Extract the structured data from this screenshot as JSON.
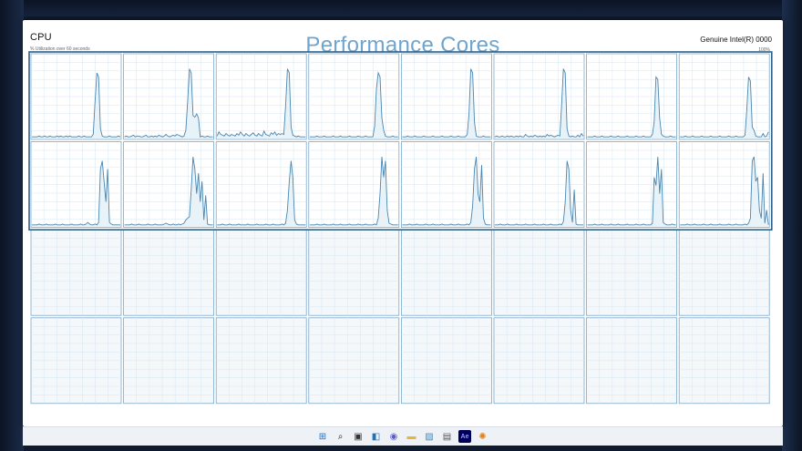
{
  "window": {
    "title": "CPU",
    "subtitle": "% Utilization over 60 seconds",
    "cpu_name": "Genuine Intel(R) 0000",
    "max_label": "100%"
  },
  "overlay": {
    "title": "Performance Cores",
    "highlight_color": "#2d5f87"
  },
  "graph_colors": {
    "line": "#4a86b0",
    "fill": "#e8f2f9",
    "grid": "#d6e6f1",
    "border": "#7aa7c7"
  },
  "cpu_graphs": {
    "rows": 4,
    "cols": 8,
    "active_rows": 2,
    "series": [
      [
        2,
        2,
        2,
        2,
        3,
        2,
        2,
        3,
        2,
        2,
        3,
        2,
        2,
        2,
        3,
        2,
        3,
        2,
        2,
        3,
        2,
        3,
        2,
        2,
        2,
        2,
        3,
        2,
        2,
        3,
        2,
        2,
        2,
        2,
        5,
        45,
        80,
        75,
        12,
        3,
        2,
        2,
        2,
        3,
        2,
        2,
        2,
        2,
        3,
        2
      ],
      [
        2,
        3,
        2,
        2,
        3,
        4,
        2,
        3,
        3,
        2,
        2,
        3,
        4,
        2,
        2,
        3,
        2,
        3,
        2,
        4,
        3,
        2,
        3,
        5,
        3,
        2,
        3,
        4,
        3,
        5,
        4,
        3,
        2,
        3,
        10,
        45,
        85,
        80,
        28,
        26,
        30,
        25,
        2,
        3,
        2,
        2,
        3,
        2,
        2,
        2
      ],
      [
        3,
        8,
        5,
        4,
        3,
        6,
        4,
        3,
        5,
        4,
        3,
        6,
        4,
        8,
        5,
        3,
        6,
        4,
        3,
        5,
        7,
        4,
        3,
        6,
        4,
        3,
        9,
        5,
        4,
        3,
        7,
        5,
        8,
        4,
        6,
        5,
        6,
        5,
        40,
        85,
        80,
        14,
        4,
        3,
        2,
        3,
        2,
        2,
        2,
        2
      ],
      [
        2,
        2,
        2,
        2,
        3,
        2,
        2,
        2,
        3,
        2,
        2,
        2,
        2,
        3,
        2,
        2,
        2,
        3,
        2,
        2,
        2,
        2,
        3,
        2,
        2,
        2,
        2,
        3,
        2,
        2,
        2,
        3,
        2,
        2,
        2,
        2,
        15,
        60,
        80,
        75,
        25,
        10,
        3,
        2,
        2,
        2,
        3,
        2,
        2,
        2
      ],
      [
        2,
        2,
        2,
        3,
        2,
        2,
        2,
        3,
        2,
        2,
        2,
        2,
        3,
        2,
        2,
        2,
        2,
        3,
        2,
        2,
        2,
        2,
        3,
        2,
        2,
        2,
        2,
        3,
        2,
        2,
        2,
        3,
        2,
        2,
        2,
        2,
        5,
        30,
        85,
        80,
        20,
        3,
        2,
        2,
        2,
        3,
        2,
        2,
        2,
        2
      ],
      [
        2,
        3,
        2,
        2,
        3,
        2,
        2,
        3,
        2,
        3,
        2,
        2,
        3,
        2,
        3,
        2,
        2,
        5,
        3,
        2,
        3,
        2,
        4,
        3,
        2,
        3,
        2,
        3,
        2,
        5,
        3,
        4,
        3,
        2,
        3,
        4,
        3,
        40,
        85,
        80,
        12,
        3,
        2,
        3,
        2,
        2,
        4,
        2,
        6,
        3
      ],
      [
        2,
        2,
        2,
        2,
        3,
        2,
        2,
        2,
        3,
        2,
        2,
        2,
        2,
        3,
        2,
        2,
        2,
        3,
        2,
        2,
        2,
        2,
        3,
        2,
        2,
        2,
        2,
        3,
        2,
        2,
        2,
        3,
        2,
        2,
        2,
        2,
        5,
        20,
        75,
        72,
        25,
        5,
        3,
        2,
        2,
        2,
        3,
        2,
        2,
        2
      ],
      [
        2,
        2,
        2,
        3,
        2,
        2,
        2,
        3,
        2,
        2,
        2,
        2,
        3,
        2,
        2,
        2,
        2,
        3,
        2,
        2,
        2,
        2,
        3,
        2,
        2,
        2,
        2,
        3,
        2,
        2,
        2,
        3,
        2,
        2,
        2,
        2,
        4,
        35,
        75,
        70,
        14,
        10,
        3,
        2,
        2,
        2,
        6,
        2,
        3,
        8
      ],
      [
        2,
        2,
        2,
        2,
        3,
        2,
        2,
        2,
        3,
        2,
        2,
        2,
        2,
        3,
        2,
        2,
        2,
        3,
        2,
        2,
        2,
        2,
        3,
        2,
        2,
        2,
        2,
        3,
        2,
        2,
        3,
        5,
        3,
        2,
        2,
        3,
        2,
        5,
        70,
        80,
        55,
        30,
        70,
        5,
        3,
        2,
        2,
        2,
        2,
        2
      ],
      [
        2,
        2,
        2,
        2,
        3,
        2,
        2,
        2,
        3,
        2,
        2,
        2,
        2,
        3,
        2,
        2,
        2,
        3,
        2,
        2,
        2,
        2,
        3,
        4,
        3,
        2,
        2,
        3,
        2,
        2,
        3,
        2,
        3,
        4,
        8,
        10,
        12,
        45,
        85,
        70,
        40,
        65,
        30,
        55,
        8,
        38,
        3,
        2,
        2,
        2
      ],
      [
        2,
        2,
        2,
        3,
        2,
        2,
        2,
        3,
        2,
        2,
        2,
        2,
        3,
        2,
        2,
        2,
        2,
        3,
        2,
        2,
        2,
        2,
        3,
        2,
        2,
        2,
        2,
        3,
        2,
        2,
        2,
        3,
        2,
        2,
        2,
        2,
        3,
        2,
        4,
        20,
        55,
        80,
        60,
        8,
        3,
        2,
        2,
        2,
        2,
        2
      ],
      [
        2,
        2,
        2,
        2,
        3,
        2,
        2,
        2,
        3,
        2,
        2,
        2,
        2,
        3,
        2,
        2,
        2,
        3,
        2,
        2,
        2,
        2,
        3,
        2,
        2,
        2,
        2,
        3,
        2,
        2,
        2,
        3,
        2,
        2,
        2,
        2,
        3,
        2,
        10,
        40,
        85,
        60,
        80,
        20,
        4,
        3,
        2,
        2,
        2,
        2
      ],
      [
        2,
        2,
        2,
        2,
        3,
        2,
        2,
        2,
        3,
        2,
        2,
        2,
        2,
        3,
        2,
        2,
        2,
        3,
        2,
        2,
        2,
        2,
        3,
        2,
        2,
        2,
        2,
        3,
        2,
        2,
        2,
        3,
        2,
        2,
        2,
        2,
        3,
        2,
        5,
        25,
        70,
        85,
        40,
        30,
        75,
        10,
        3,
        2,
        2,
        2
      ],
      [
        2,
        2,
        2,
        3,
        2,
        2,
        2,
        3,
        2,
        2,
        2,
        2,
        3,
        2,
        2,
        2,
        2,
        3,
        2,
        2,
        2,
        2,
        3,
        2,
        2,
        2,
        2,
        3,
        2,
        2,
        2,
        3,
        2,
        2,
        2,
        2,
        3,
        2,
        6,
        30,
        80,
        70,
        20,
        5,
        45,
        3,
        2,
        2,
        2,
        2
      ],
      [
        2,
        2,
        2,
        2,
        3,
        2,
        2,
        2,
        3,
        2,
        2,
        2,
        2,
        3,
        2,
        2,
        2,
        3,
        2,
        2,
        2,
        2,
        3,
        2,
        2,
        2,
        2,
        3,
        2,
        2,
        2,
        3,
        2,
        2,
        2,
        2,
        4,
        60,
        50,
        85,
        40,
        70,
        5,
        3,
        2,
        2,
        2,
        3,
        2,
        2
      ],
      [
        2,
        2,
        2,
        2,
        3,
        2,
        2,
        2,
        3,
        2,
        2,
        2,
        2,
        3,
        2,
        2,
        2,
        3,
        2,
        2,
        2,
        2,
        3,
        2,
        2,
        2,
        2,
        3,
        2,
        2,
        2,
        3,
        2,
        2,
        2,
        2,
        3,
        2,
        4,
        10,
        80,
        85,
        55,
        60,
        20,
        10,
        65,
        4,
        20,
        2
      ]
    ]
  },
  "taskbar": {
    "items": [
      {
        "name": "start-icon",
        "glyph": "⊞",
        "color": "#1a73c9"
      },
      {
        "name": "search-icon",
        "glyph": "⌕",
        "color": "#222222"
      },
      {
        "name": "task-view-icon",
        "glyph": "▣",
        "color": "#333333"
      },
      {
        "name": "widgets-icon",
        "glyph": "◧",
        "color": "#1f73b7"
      },
      {
        "name": "chat-icon",
        "glyph": "◉",
        "color": "#5b5fc7"
      },
      {
        "name": "file-explorer-icon",
        "glyph": "▬",
        "color": "#e7b43a"
      },
      {
        "name": "photos-icon",
        "glyph": "▨",
        "color": "#4a86b0"
      },
      {
        "name": "documents-icon",
        "glyph": "▤",
        "color": "#555555"
      },
      {
        "name": "after-effects-icon",
        "glyph": "Ae",
        "color": "#9999ff"
      },
      {
        "name": "blender-icon",
        "glyph": "✺",
        "color": "#e87d0d"
      }
    ]
  }
}
